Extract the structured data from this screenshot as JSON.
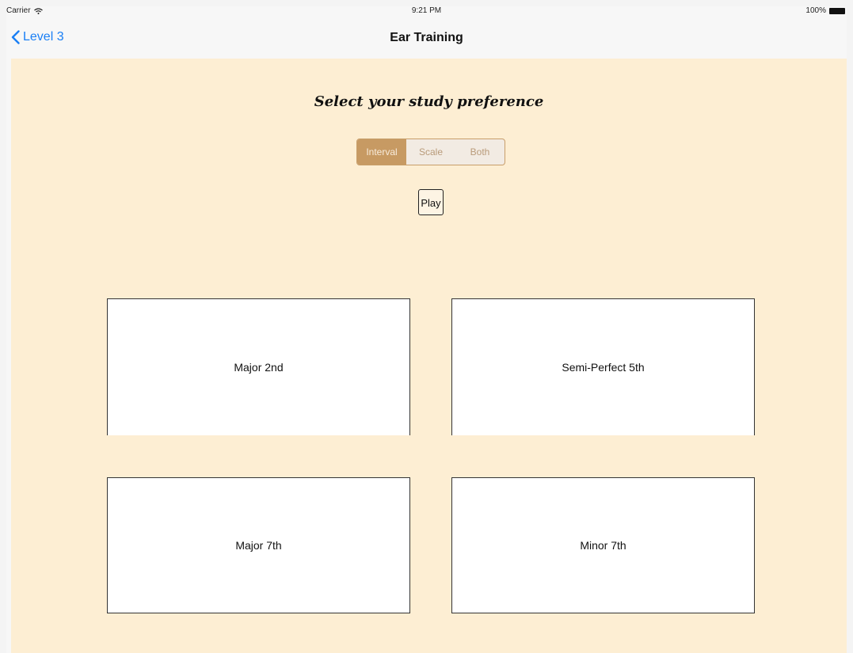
{
  "status_bar": {
    "carrier": "Carrier",
    "time": "9:21 PM",
    "battery": "100%"
  },
  "nav": {
    "back_label": "Level 3",
    "title": "Ear Training"
  },
  "main": {
    "prompt": "Select your study preference",
    "segments": [
      {
        "label": "Interval",
        "selected": true
      },
      {
        "label": "Scale",
        "selected": false
      },
      {
        "label": "Both",
        "selected": false
      }
    ],
    "play_label": "Play",
    "answers": [
      {
        "label": "Major 2nd"
      },
      {
        "label": "Semi-Perfect 5th"
      },
      {
        "label": "Major 7th"
      },
      {
        "label": "Minor 7th"
      }
    ]
  },
  "colors": {
    "background": "#fdeed3",
    "accent": "#c79a63",
    "link": "#1a7ff5"
  },
  "icons": [
    "wifi-icon",
    "battery-icon",
    "chevron-left-icon"
  ]
}
